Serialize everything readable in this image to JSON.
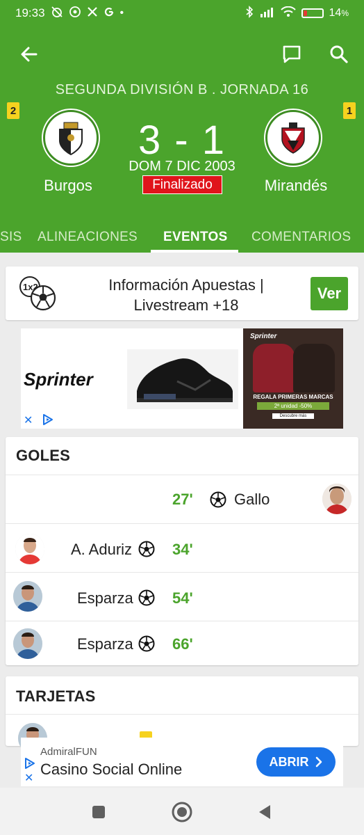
{
  "status_bar": {
    "time": "19:33",
    "battery": "14",
    "battery_unit": "%"
  },
  "header": {
    "competition": "SEGUNDA DIVISIÓN B .  JORNADA 16",
    "home": {
      "name": "Burgos",
      "table_position": "2"
    },
    "away": {
      "name": "Mirandés",
      "table_position": "1"
    },
    "score": "3 - 1",
    "date": "DOM 7 DIC 2003",
    "status": "Finalizado"
  },
  "tabs": [
    {
      "label": "SIS"
    },
    {
      "label": "ALINEACIONES"
    },
    {
      "label": "EVENTOS",
      "active": true
    },
    {
      "label": "COMENTARIOS"
    }
  ],
  "betting": {
    "text_line1": "Información Apuestas |",
    "text_line2": "Livestream +18",
    "button_label": "Ver"
  },
  "ad_banner": {
    "brand": "Sprinter",
    "small_brand": "Sprinter",
    "promo_line1": "REGALA PRIMERAS MARCAS",
    "promo_line2": "2ª unidad -50%",
    "promo_line3": "Descubre más",
    "close": "✕"
  },
  "goals": {
    "title": "GOLES",
    "rows": [
      {
        "side": "away",
        "minute": "27'",
        "player": "Gallo"
      },
      {
        "side": "home",
        "minute": "34'",
        "player": "A. Aduriz"
      },
      {
        "side": "home",
        "minute": "54'",
        "player": "Esparza"
      },
      {
        "side": "home",
        "minute": "66'",
        "player": "Esparza"
      }
    ]
  },
  "cards": {
    "title": "TARJETAS"
  },
  "bottom_ad": {
    "advertiser": "AdmiralFUN",
    "headline": "Casino Social Online",
    "button_label": "ABRIR",
    "close": "✕"
  },
  "colors": {
    "primary_green": "#4ba42c",
    "status_red": "#e0141b",
    "position_yellow": "#f6d21f",
    "ad_blue": "#1a73e8"
  }
}
